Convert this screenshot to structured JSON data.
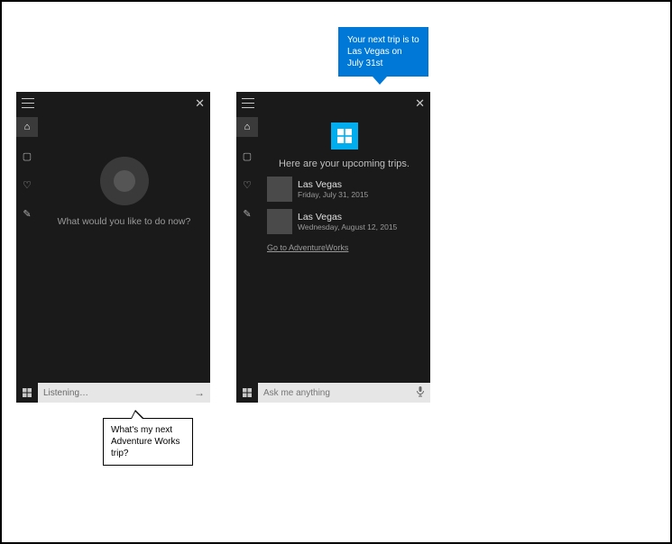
{
  "left": {
    "prompt": "What would you like to do now?",
    "input_value": "Listening…"
  },
  "right": {
    "heading": "Here are your upcoming trips.",
    "trips": [
      {
        "title": "Las Vegas",
        "date": "Friday, July 31, 2015"
      },
      {
        "title": "Las Vegas",
        "date": "Wednesday, August 12, 2015"
      }
    ],
    "deeplink": "Go to AdventureWorks",
    "input_placeholder": "Ask me anything"
  },
  "bubble_user": "What's my next Adventure Works trip?",
  "bubble_cortana": "Your next trip is to Las Vegas on July 31st"
}
